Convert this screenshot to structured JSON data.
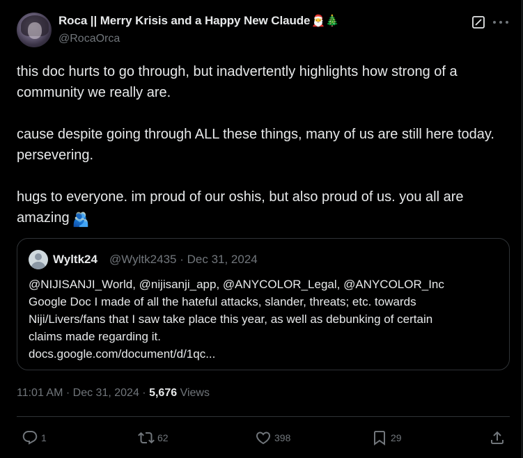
{
  "author": {
    "display_name": "Roca || Merry Krisis and a Happy New Claude",
    "name_emojis": "🎅🎄",
    "handle": "@RocaOrca"
  },
  "header_icons": {
    "grok": "grok-icon",
    "more": "more-options-icon"
  },
  "tweet": {
    "paragraphs": [
      "this doc hurts to go through, but inadvertently highlights how strong of a community we really are.",
      "cause despite going through ALL these things, many of us are still here today. persevering.",
      "hugs to everyone. im proud of our oshis, but also proud of us. you all are amazing"
    ],
    "trailing_emoji": "🫂"
  },
  "quote": {
    "name": "Wyltk24",
    "handle": "@Wyltk2435",
    "separator": "·",
    "date": "Dec 31, 2024",
    "lines": [
      "@NIJISANJI_World, @nijisanji_app, @ANYCOLOR_Legal, @ANYCOLOR_Inc",
      "Google Doc I made of all the hateful attacks, slander, threats; etc. towards",
      "Niji/Livers/fans that I saw take place this year, as well as debunking of certain",
      "claims made regarding it.",
      "docs.google.com/document/d/1qc..."
    ]
  },
  "meta": {
    "time": "11:01 AM",
    "separator": "·",
    "date": "Dec 31, 2024",
    "views_count": "5,676",
    "views_label": "Views"
  },
  "actions": {
    "replies": "1",
    "reposts": "62",
    "likes": "398",
    "bookmarks": "29"
  },
  "colors": {
    "background": "#000000",
    "text_primary": "#e7e9ea",
    "text_secondary": "#71767b",
    "border": "#2f3336"
  }
}
